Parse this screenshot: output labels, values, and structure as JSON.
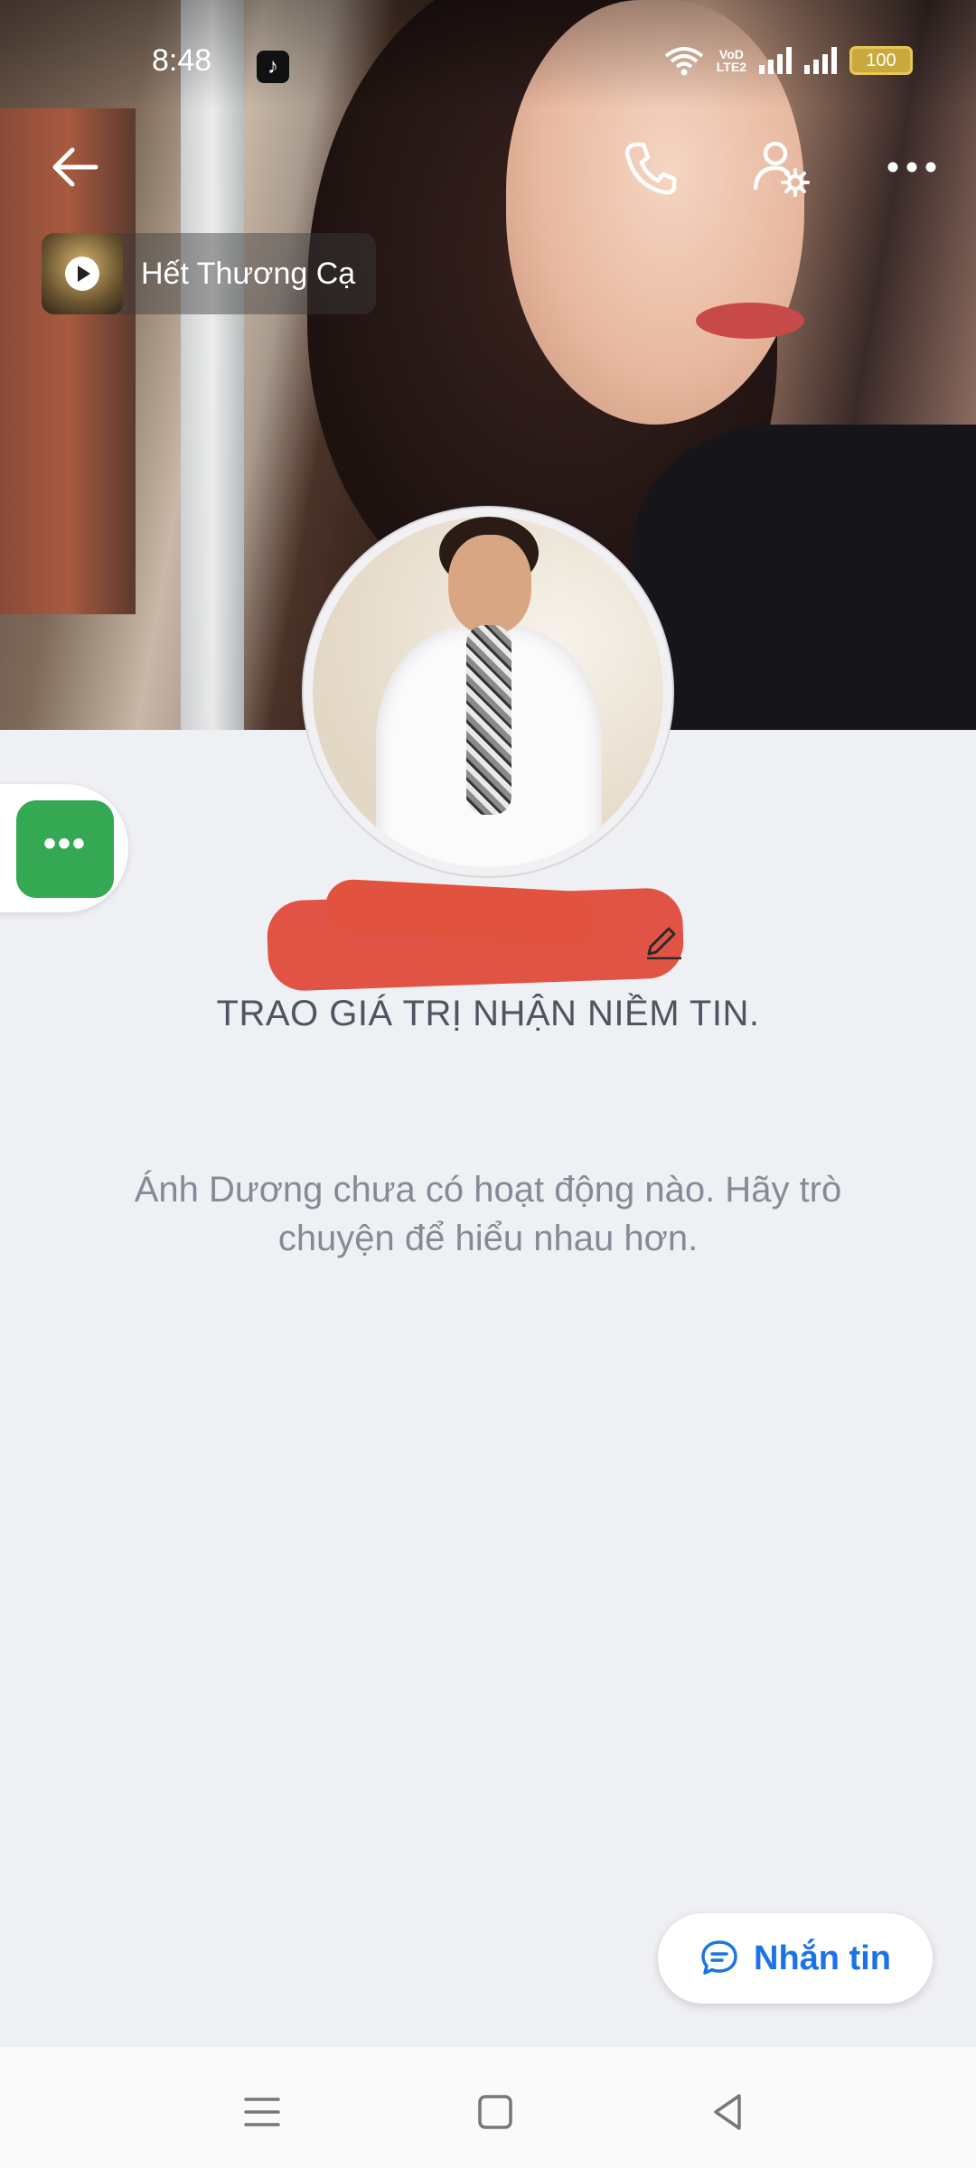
{
  "status_bar": {
    "time": "8:48",
    "battery": "100",
    "network_label_top": "VoD",
    "network_label_bottom": "LTE2"
  },
  "header": {
    "back_icon": "arrow-left-icon",
    "call_icon": "phone-icon",
    "profile_settings_icon": "user-gear-icon",
    "more_icon": "more-horizontal-icon"
  },
  "music": {
    "title": "Hết Thương Cạ"
  },
  "profile": {
    "bio": "TRAO GIÁ TRỊ NHẬN NIỀM TIN.",
    "empty_activity": "Ánh Dương chưa có hoạt động nào. Hãy trò chuyện để hiểu nhau hơn."
  },
  "menu_fab": {
    "label": "•••"
  },
  "message_button": {
    "label": "Nhắn tin"
  },
  "colors": {
    "accent_green": "#34a853",
    "accent_blue": "#1a73e8",
    "background": "#eff0f4",
    "redaction": "#df4a3a"
  }
}
